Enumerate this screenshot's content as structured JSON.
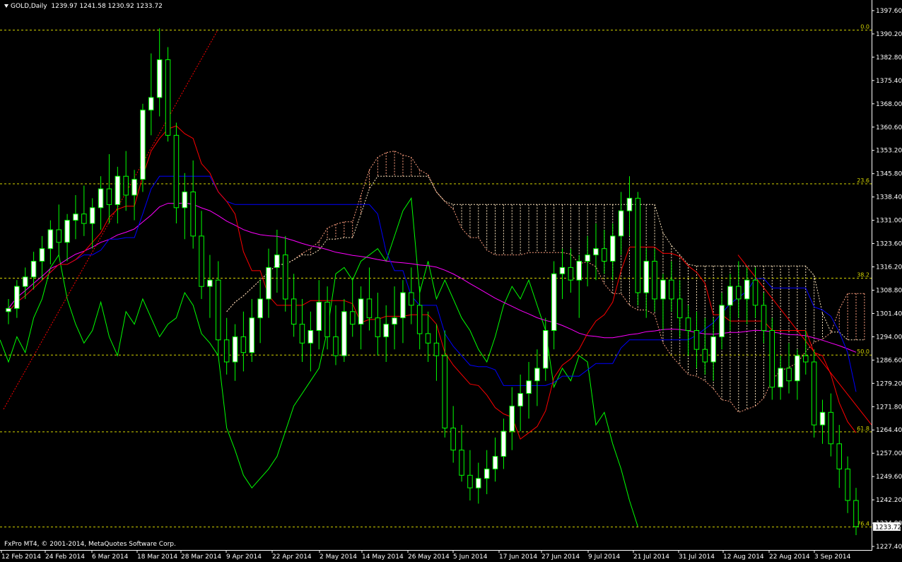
{
  "header": {
    "symbol_timeframe": "GOLD,Daily",
    "ohlc": "1239.97 1241.58 1230.92 1233.72"
  },
  "footer": {
    "copyright": "FxPro MT4, © 2001-2014, MetaQuotes Software Corp."
  },
  "colors": {
    "background": "#000000",
    "axis": "#ffffff",
    "bull_candle": "#ffffff",
    "bear_candle": "#000000",
    "wick": "#00ff00",
    "fib": "#d4d400",
    "tenkan": "#ff0000",
    "kijun": "#0000ff",
    "chikou": "#00ff00",
    "ma": "#ff00ff",
    "cloud_up": "#ff9f7f",
    "cloud_down": "#ffe7c0",
    "trendline": "#ff0000"
  },
  "chart_data": {
    "type": "candlestick",
    "symbol": "GOLD",
    "timeframe": "Daily",
    "last_price": "1233.72",
    "ylim": [
      1227.4,
      1397.6
    ],
    "y_ticks": [
      "1397.60",
      "1390.20",
      "1382.80",
      "1375.40",
      "1368.00",
      "1360.60",
      "1353.20",
      "1345.80",
      "1338.40",
      "1331.00",
      "1323.60",
      "1316.20",
      "1308.80",
      "1301.40",
      "1294.00",
      "1286.60",
      "1279.20",
      "1271.80",
      "1264.40",
      "1257.00",
      "1249.60",
      "1242.20",
      "1234.80",
      "1227.40"
    ],
    "x_labels": [
      "12 Feb 2014",
      "24 Feb 2014",
      "6 Mar 2014",
      "18 Mar 2014",
      "28 Mar 2014",
      "9 Apr 2014",
      "22 Apr 2014",
      "2 May 2014",
      "14 May 2014",
      "26 May 2014",
      "5 Jun 2014",
      "17 Jun 2014",
      "27 Jun 2014",
      "9 Jul 2014",
      "21 Jul 2014",
      "31 Jul 2014",
      "12 Aug 2014",
      "22 Aug 2014",
      "3 Sep 2014"
    ],
    "fib_levels": [
      {
        "label": "0.0",
        "price": 1391.4
      },
      {
        "label": "23.6",
        "price": 1342.6
      },
      {
        "label": "38.2",
        "price": 1312.6
      },
      {
        "label": "50.0",
        "price": 1288.2
      },
      {
        "label": "61.8",
        "price": 1263.8
      },
      {
        "label": "76.4",
        "price": 1233.6
      }
    ],
    "candles": [
      [
        1302,
        1306,
        1298,
        1303
      ],
      [
        1303,
        1312,
        1300,
        1310
      ],
      [
        1310,
        1316,
        1306,
        1313
      ],
      [
        1313,
        1321,
        1309,
        1318
      ],
      [
        1318,
        1326,
        1312,
        1322
      ],
      [
        1322,
        1331,
        1317,
        1328
      ],
      [
        1328,
        1336,
        1320,
        1324
      ],
      [
        1324,
        1333,
        1318,
        1331
      ],
      [
        1331,
        1339,
        1325,
        1333
      ],
      [
        1333,
        1342,
        1326,
        1330
      ],
      [
        1330,
        1338,
        1322,
        1335
      ],
      [
        1335,
        1345,
        1328,
        1341
      ],
      [
        1341,
        1352,
        1330,
        1336
      ],
      [
        1336,
        1348,
        1330,
        1345
      ],
      [
        1345,
        1353,
        1334,
        1339
      ],
      [
        1339,
        1347,
        1331,
        1344
      ],
      [
        1344,
        1368,
        1340,
        1366
      ],
      [
        1366,
        1384,
        1358,
        1370
      ],
      [
        1370,
        1392,
        1364,
        1382
      ],
      [
        1382,
        1386,
        1356,
        1358
      ],
      [
        1358,
        1362,
        1330,
        1335
      ],
      [
        1335,
        1346,
        1325,
        1340
      ],
      [
        1340,
        1350,
        1322,
        1326
      ],
      [
        1326,
        1334,
        1306,
        1310
      ],
      [
        1310,
        1320,
        1300,
        1312
      ],
      [
        1312,
        1318,
        1288,
        1293
      ],
      [
        1293,
        1300,
        1282,
        1286
      ],
      [
        1286,
        1298,
        1280,
        1294
      ],
      [
        1294,
        1302,
        1283,
        1289
      ],
      [
        1289,
        1306,
        1286,
        1300
      ],
      [
        1300,
        1312,
        1292,
        1306
      ],
      [
        1306,
        1322,
        1300,
        1316
      ],
      [
        1316,
        1328,
        1308,
        1320
      ],
      [
        1320,
        1326,
        1302,
        1306
      ],
      [
        1306,
        1314,
        1294,
        1298
      ],
      [
        1298,
        1306,
        1286,
        1292
      ],
      [
        1292,
        1302,
        1283,
        1296
      ],
      [
        1296,
        1312,
        1290,
        1305
      ],
      [
        1305,
        1310,
        1290,
        1294
      ],
      [
        1294,
        1304,
        1285,
        1288
      ],
      [
        1288,
        1306,
        1286,
        1302
      ],
      [
        1302,
        1312,
        1294,
        1298
      ],
      [
        1298,
        1310,
        1290,
        1306
      ],
      [
        1306,
        1316,
        1296,
        1300
      ],
      [
        1300,
        1308,
        1288,
        1294
      ],
      [
        1294,
        1304,
        1286,
        1298
      ],
      [
        1298,
        1310,
        1290,
        1300
      ],
      [
        1300,
        1312,
        1292,
        1308
      ],
      [
        1308,
        1316,
        1298,
        1304
      ],
      [
        1304,
        1310,
        1290,
        1295
      ],
      [
        1295,
        1302,
        1286,
        1292
      ],
      [
        1292,
        1298,
        1280,
        1288
      ],
      [
        1288,
        1296,
        1262,
        1265
      ],
      [
        1265,
        1272,
        1254,
        1258
      ],
      [
        1258,
        1266,
        1248,
        1250
      ],
      [
        1250,
        1258,
        1242,
        1246
      ],
      [
        1246,
        1254,
        1241,
        1249
      ],
      [
        1249,
        1258,
        1244,
        1252
      ],
      [
        1252,
        1262,
        1248,
        1256
      ],
      [
        1256,
        1268,
        1252,
        1264
      ],
      [
        1264,
        1278,
        1258,
        1272
      ],
      [
        1272,
        1282,
        1264,
        1276
      ],
      [
        1276,
        1286,
        1268,
        1280
      ],
      [
        1280,
        1290,
        1272,
        1284
      ],
      [
        1284,
        1300,
        1280,
        1296
      ],
      [
        1296,
        1318,
        1290,
        1314
      ],
      [
        1314,
        1322,
        1306,
        1316
      ],
      [
        1316,
        1322,
        1308,
        1312
      ],
      [
        1312,
        1320,
        1300,
        1318
      ],
      [
        1318,
        1326,
        1310,
        1320
      ],
      [
        1320,
        1330,
        1312,
        1322
      ],
      [
        1322,
        1328,
        1314,
        1318
      ],
      [
        1318,
        1330,
        1312,
        1326
      ],
      [
        1326,
        1340,
        1320,
        1334
      ],
      [
        1334,
        1345,
        1326,
        1338
      ],
      [
        1338,
        1340,
        1304,
        1308
      ],
      [
        1308,
        1322,
        1300,
        1318
      ],
      [
        1318,
        1322,
        1302,
        1306
      ],
      [
        1306,
        1314,
        1296,
        1312
      ],
      [
        1312,
        1318,
        1302,
        1306
      ],
      [
        1306,
        1312,
        1294,
        1300
      ],
      [
        1300,
        1304,
        1288,
        1296
      ],
      [
        1296,
        1302,
        1284,
        1290
      ],
      [
        1290,
        1300,
        1282,
        1286
      ],
      [
        1286,
        1300,
        1280,
        1294
      ],
      [
        1294,
        1308,
        1290,
        1304
      ],
      [
        1304,
        1314,
        1296,
        1310
      ],
      [
        1310,
        1318,
        1300,
        1306
      ],
      [
        1306,
        1316,
        1298,
        1312
      ],
      [
        1312,
        1316,
        1300,
        1304
      ],
      [
        1304,
        1308,
        1292,
        1296
      ],
      [
        1296,
        1300,
        1274,
        1278
      ],
      [
        1278,
        1288,
        1274,
        1284
      ],
      [
        1284,
        1292,
        1276,
        1280
      ],
      [
        1280,
        1290,
        1274,
        1288
      ],
      [
        1288,
        1296,
        1282,
        1286
      ],
      [
        1286,
        1290,
        1262,
        1266
      ],
      [
        1266,
        1274,
        1260,
        1270
      ],
      [
        1270,
        1276,
        1256,
        1260
      ],
      [
        1260,
        1266,
        1246,
        1252
      ],
      [
        1252,
        1256,
        1238,
        1242
      ],
      [
        1242,
        1246,
        1231,
        1233.72
      ]
    ]
  }
}
